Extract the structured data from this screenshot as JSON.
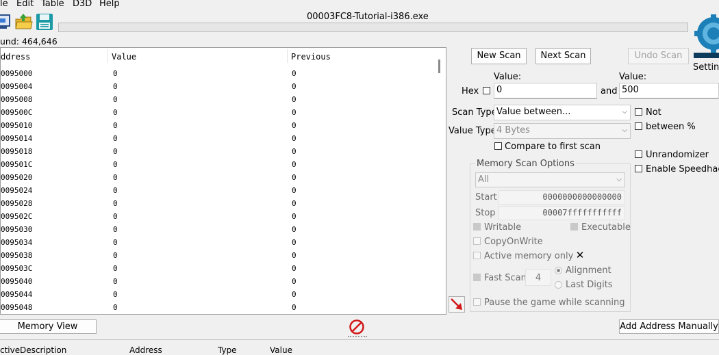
{
  "menu": [
    "le",
    "Edit",
    "Table",
    "D3D",
    "Help"
  ],
  "toolbar": {
    "icons": [
      "process-list-icon",
      "open-folder-icon",
      "save-icon"
    ]
  },
  "window_title": "00003FC8-Tutorial-i386.exe",
  "found": "und: 464,646",
  "settings_label": "Setting",
  "results": {
    "headers": [
      "ddress",
      "Value",
      "Previous"
    ],
    "rows": [
      [
        "0095000",
        "0",
        "0"
      ],
      [
        "0095004",
        "0",
        "0"
      ],
      [
        "0095008",
        "0",
        "0"
      ],
      [
        "009500C",
        "0",
        "0"
      ],
      [
        "0095010",
        "0",
        "0"
      ],
      [
        "0095014",
        "0",
        "0"
      ],
      [
        "0095018",
        "0",
        "0"
      ],
      [
        "009501C",
        "0",
        "0"
      ],
      [
        "0095020",
        "0",
        "0"
      ],
      [
        "0095024",
        "0",
        "0"
      ],
      [
        "0095028",
        "0",
        "0"
      ],
      [
        "009502C",
        "0",
        "0"
      ],
      [
        "0095030",
        "0",
        "0"
      ],
      [
        "0095034",
        "0",
        "0"
      ],
      [
        "0095038",
        "0",
        "0"
      ],
      [
        "009503C",
        "0",
        "0"
      ],
      [
        "0095040",
        "0",
        "0"
      ],
      [
        "0095044",
        "0",
        "0"
      ],
      [
        "0095048",
        "0",
        "0"
      ]
    ]
  },
  "scan": {
    "new_scan": "New Scan",
    "next_scan": "Next Scan",
    "undo_scan": "Undo Scan",
    "value_label_1": "Value:",
    "value_label_2": "Value:",
    "hex_label": "Hex",
    "value_1": "0",
    "and_label": "and",
    "value_2": "500",
    "scan_type_label": "Scan Type",
    "scan_type": "Value between...",
    "value_type_label": "Value Type",
    "value_type": "4 Bytes",
    "compare_first": "Compare to first scan",
    "not_label": "Not",
    "between_pct": "between %",
    "unrandomizer": "Unrandomizer",
    "speedhack": "Enable Speedhack"
  },
  "memory_options": {
    "title": "Memory Scan Options",
    "region": "All",
    "start_label": "Start",
    "start_value": "0000000000000000",
    "stop_label": "Stop",
    "stop_value": "00007fffffffffff",
    "writable": "Writable",
    "executable": "Executable",
    "copy_on_write": "CopyOnWrite",
    "active_memory": "Active memory only",
    "fast_scan": "Fast Scan",
    "fast_scan_value": "4",
    "alignment": "Alignment",
    "last_digits": "Last Digits",
    "pause_game": "Pause the game while scanning"
  },
  "bottom": {
    "memory_view": "Memory View",
    "add_address": "Add Address Manually"
  },
  "address_list": {
    "headers": [
      "ctive",
      "Description",
      "Address",
      "Type",
      "Value"
    ]
  }
}
